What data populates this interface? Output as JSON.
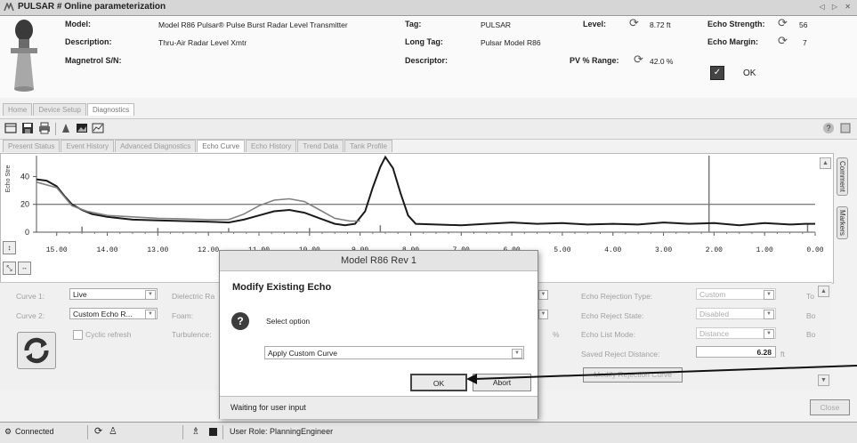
{
  "window": {
    "title": "PULSAR # Online parameterization",
    "controls": "◁ ▷ ✕"
  },
  "header": {
    "model_label": "Model:",
    "model_value": "Model R86 Pulsar® Pulse Burst Radar Level Transmitter",
    "description_label": "Description:",
    "description_value": "Thru-Air Radar Level Xmtr",
    "magnetrol_label": "Magnetrol S/N:",
    "tag_label": "Tag:",
    "tag_value": "PULSAR",
    "long_tag_label": "Long Tag:",
    "long_tag_value": "Pulsar Model R86",
    "descriptor_label": "Descriptor:",
    "level_label": "Level:",
    "level_value": "8.72 ft",
    "pv_range_label": "PV % Range:",
    "pv_range_value": "42.0 %",
    "echo_strength_label": "Echo Strength:",
    "echo_strength_value": "56",
    "echo_margin_label": "Echo Margin:",
    "echo_margin_value": "7",
    "status_value": "OK"
  },
  "main_tabs": [
    "Home",
    "Device Setup",
    "Diagnostics"
  ],
  "sub_tabs": [
    "Present Status",
    "Event History",
    "Advanced Diagnostics",
    "Echo Curve",
    "Echo History",
    "Trend Data",
    "Tank Profile"
  ],
  "side_tabs": {
    "comment": "Comment",
    "markers": "Markers"
  },
  "chart_data": {
    "type": "line",
    "ylabel": "Echo Stre",
    "x_ticks": [
      "15.00",
      "14.00",
      "13.00",
      "12.00",
      "11.00",
      "10.00",
      "9.00",
      "8.00",
      "7.00",
      "6.00",
      "5.00",
      "4.00",
      "3.00",
      "2.00",
      "1.00",
      "0.00"
    ],
    "y_ticks": [
      "0",
      "20",
      "40"
    ],
    "ylim": [
      0,
      55
    ],
    "x_reversed": true,
    "xlim": [
      0,
      15.4
    ],
    "threshold_y": 20,
    "series": [
      {
        "color": "#1a1a1a",
        "points": [
          [
            15.4,
            38
          ],
          [
            15.2,
            37
          ],
          [
            15.0,
            33
          ],
          [
            14.85,
            26
          ],
          [
            14.7,
            20
          ],
          [
            14.5,
            16
          ],
          [
            14.3,
            13
          ],
          [
            14.0,
            11
          ],
          [
            13.5,
            9
          ],
          [
            13.0,
            8.5
          ],
          [
            12.5,
            8
          ],
          [
            12.0,
            7.5
          ],
          [
            11.6,
            7
          ],
          [
            11.3,
            9
          ],
          [
            11.0,
            12
          ],
          [
            10.7,
            15
          ],
          [
            10.4,
            16
          ],
          [
            10.1,
            14
          ],
          [
            9.8,
            10
          ],
          [
            9.5,
            6
          ],
          [
            9.3,
            5
          ],
          [
            9.1,
            6
          ],
          [
            8.9,
            15
          ],
          [
            8.75,
            32
          ],
          [
            8.6,
            47
          ],
          [
            8.5,
            54
          ],
          [
            8.35,
            46
          ],
          [
            8.2,
            28
          ],
          [
            8.05,
            12
          ],
          [
            7.9,
            6
          ],
          [
            7.5,
            5.5
          ],
          [
            7.0,
            5
          ],
          [
            6.5,
            6
          ],
          [
            6.0,
            7
          ],
          [
            5.5,
            6
          ],
          [
            5.0,
            6.5
          ],
          [
            4.5,
            5.5
          ],
          [
            4.0,
            6
          ],
          [
            3.5,
            5.5
          ],
          [
            3.0,
            7
          ],
          [
            2.5,
            6
          ],
          [
            2.0,
            6.5
          ],
          [
            1.5,
            5
          ],
          [
            1.0,
            6.5
          ],
          [
            0.5,
            5.5
          ],
          [
            0.2,
            6
          ],
          [
            0.0,
            6
          ]
        ]
      },
      {
        "color": "#808080",
        "points": [
          [
            15.4,
            36
          ],
          [
            15.0,
            32
          ],
          [
            14.7,
            19
          ],
          [
            14.4,
            15
          ],
          [
            14.0,
            12
          ],
          [
            13.5,
            11
          ],
          [
            13.0,
            10
          ],
          [
            12.5,
            9.5
          ],
          [
            12.0,
            9
          ],
          [
            11.6,
            9
          ],
          [
            11.3,
            13
          ],
          [
            11.0,
            19
          ],
          [
            10.7,
            23
          ],
          [
            10.4,
            24
          ],
          [
            10.1,
            22
          ],
          [
            9.8,
            16
          ],
          [
            9.5,
            10
          ],
          [
            9.2,
            8
          ],
          [
            9.0,
            8
          ]
        ]
      }
    ]
  },
  "params": {
    "curve1_label": "Curve 1:",
    "curve1_value": "Live",
    "curve2_label": "Curve 2:",
    "curve2_value": "Custom Echo R...",
    "cyclic_label": "Cyclic refresh",
    "dielectric_label": "Dielectric Ra",
    "foam_label": "Foam:",
    "turbulence_label": "Turbulence:",
    "percent_unit": "%",
    "echo_rejection_type_label": "Echo Rejection Type:",
    "echo_rejection_type_value": "Custom",
    "echo_reject_state_label": "Echo Reject State:",
    "echo_reject_state_value": "Disabled",
    "echo_list_mode_label": "Echo List Mode:",
    "echo_list_mode_value": "Distance",
    "saved_reject_distance_label": "Saved Reject Distance:",
    "saved_reject_distance_value": "6.28",
    "saved_reject_distance_unit": "ft",
    "modify_rejection_label": "Modify Rejection Curve",
    "col3_labels": [
      "To",
      "Bo",
      "Bo"
    ],
    "close_label": "Close"
  },
  "modal": {
    "title": "Model R86 Rev 1",
    "heading": "Modify Existing Echo",
    "prompt": "Select option",
    "select_value": "Apply Custom Curve",
    "ok_label": "OK",
    "abort_label": "Abort",
    "status": "Waiting for user input"
  },
  "statusbar": {
    "connected": "Connected",
    "user_role": "User Role: PlanningEngineer"
  }
}
